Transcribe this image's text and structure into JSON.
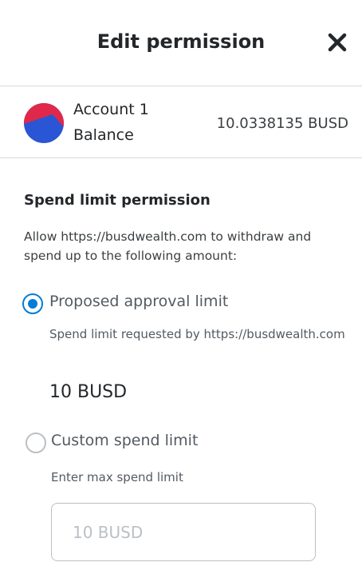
{
  "header": {
    "title": "Edit permission"
  },
  "account": {
    "name": "Account 1",
    "balance_label": "Balance",
    "balance_value": "10.0338135 BUSD"
  },
  "permission": {
    "title": "Spend limit permission",
    "description": "Allow https://busdwealth.com to withdraw and spend up to the following amount:"
  },
  "options": {
    "proposed": {
      "label": "Proposed approval limit",
      "selected": true,
      "sub_label": "Spend limit requested by https://busdwealth.com",
      "amount": "10 BUSD"
    },
    "custom": {
      "label": "Custom spend limit",
      "selected": false,
      "sub_label": "Enter max spend limit",
      "placeholder": "10 BUSD"
    }
  },
  "icons": {
    "close": "close-icon",
    "avatar": "account-avatar-icon"
  },
  "colors": {
    "accent": "#037dd6",
    "avatar_red": "#e0284a",
    "avatar_blue": "#2a55d5"
  }
}
